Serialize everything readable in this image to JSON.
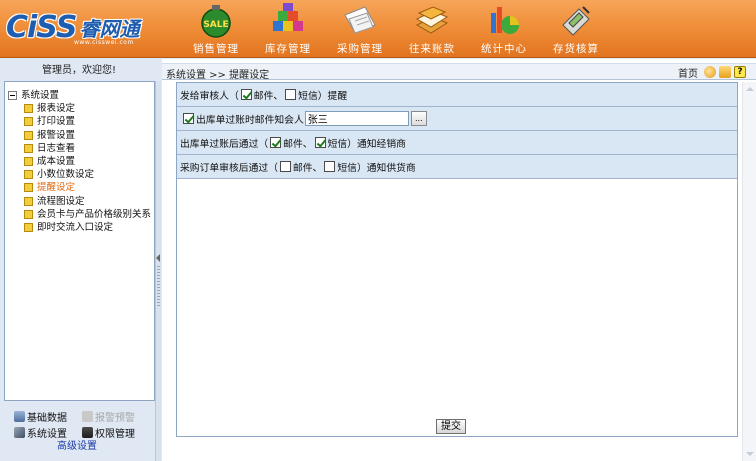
{
  "brand": {
    "logo_text": "CiSS",
    "logo_cn": "睿网通",
    "url": "www.cisswei.com"
  },
  "nav": [
    {
      "label": "销售管理",
      "icon": "sale-icon"
    },
    {
      "label": "库存管理",
      "icon": "blocks-icon"
    },
    {
      "label": "采购管理",
      "icon": "papers-icon"
    },
    {
      "label": "往来账款",
      "icon": "ledger-icon"
    },
    {
      "label": "统计中心",
      "icon": "pie-chart-icon"
    },
    {
      "label": "存货核算",
      "icon": "calculator-icon"
    }
  ],
  "sidebar": {
    "welcome": "管理员，欢迎您!",
    "root": "系统设置",
    "items": [
      {
        "label": "报表设定"
      },
      {
        "label": "打印设置"
      },
      {
        "label": "报警设置"
      },
      {
        "label": "日志查看"
      },
      {
        "label": "成本设置"
      },
      {
        "label": "小数位数设定"
      },
      {
        "label": "提醒设定",
        "active": true
      },
      {
        "label": "流程图设定"
      },
      {
        "label": "会员卡与产品价格级别关系"
      },
      {
        "label": "即时交流入口设定"
      }
    ],
    "bottom_menu": {
      "basic_data": "基础数据",
      "alarm_warning": "报警预警",
      "system_settings": "系统设置",
      "permission_mgmt": "权限管理",
      "advanced_settings": "高级设置"
    }
  },
  "breadcrumb": {
    "text": "系统设置 >> 提醒设定",
    "home": "首页"
  },
  "form": {
    "row1": {
      "prefix": "发给审核人（",
      "email": "邮件、",
      "email_checked": true,
      "sms": "短信）提醒",
      "sms_checked": false
    },
    "row2": {
      "label": "出库单过账时邮件知会人",
      "checked": true,
      "input_value": "张三",
      "browse": "..."
    },
    "row3": {
      "prefix": "出库单过账后通过（",
      "email": "邮件、",
      "email_checked": true,
      "sms": "短信）通知经销商",
      "sms_checked": true
    },
    "row4": {
      "prefix": "采购订单审核后通过（",
      "email": "邮件、",
      "email_checked": false,
      "sms": "短信）通知供货商",
      "sms_checked": false
    },
    "submit": "提交"
  },
  "colors": {
    "banner": "#f08f3a",
    "panel": "#dfe8f3",
    "row": "#d9e6f4",
    "active_link": "#e06a12"
  }
}
